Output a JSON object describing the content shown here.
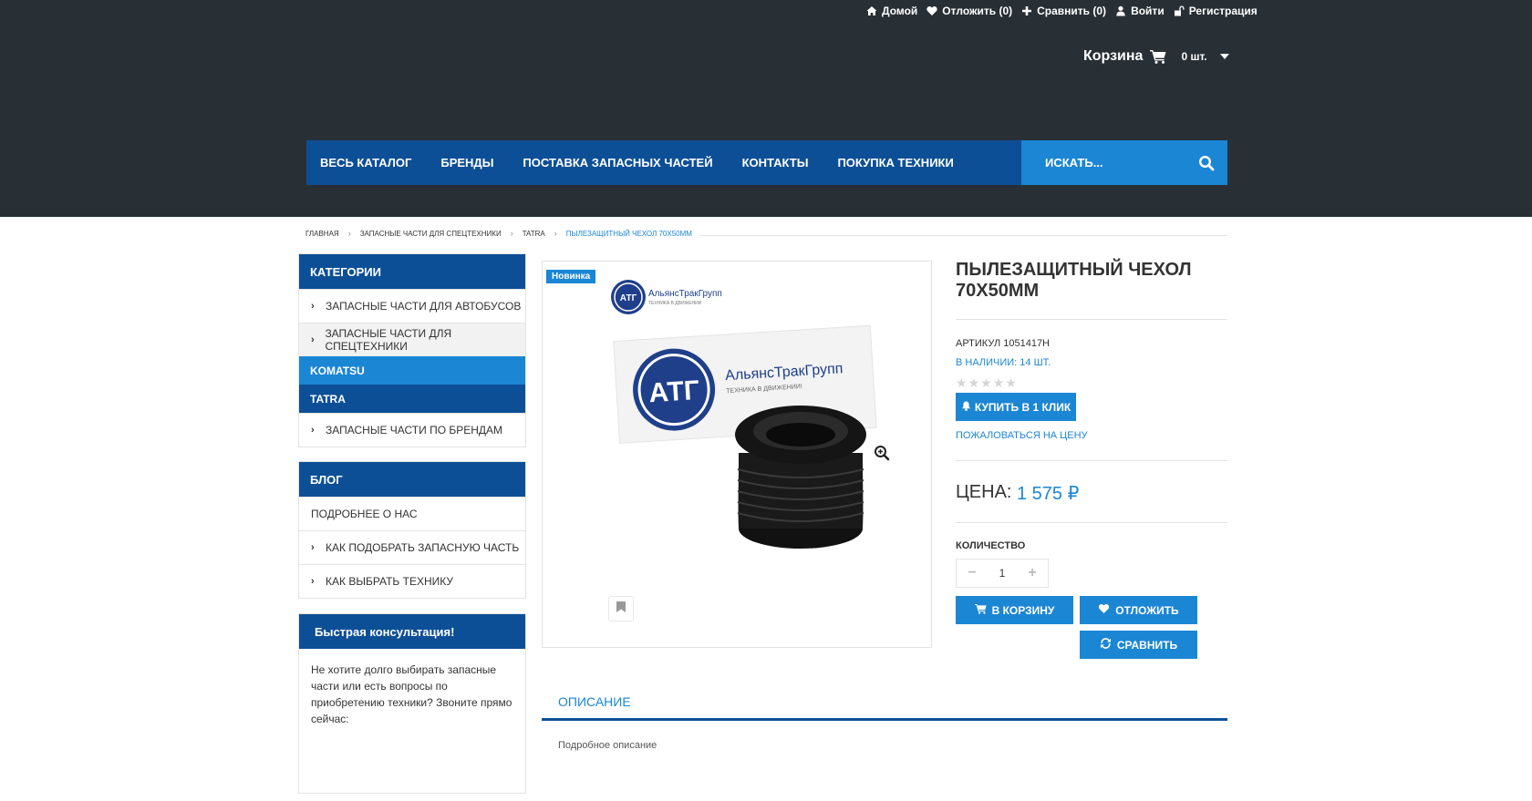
{
  "header": {
    "top_links": [
      {
        "label": "Домой",
        "icon": "home-icon"
      },
      {
        "label": "Отложить (0)",
        "icon": "heart-icon"
      },
      {
        "label": "Сравнить (0)",
        "icon": "plus-icon"
      },
      {
        "label": "Войти",
        "icon": "user-icon"
      },
      {
        "label": "Регистрация",
        "icon": "unlock-icon"
      }
    ],
    "cart": {
      "label": "Корзина",
      "count": "0 шт.",
      "icon": "cart-icon"
    },
    "nav": [
      "ВЕСЬ КАТАЛОГ",
      "БРЕНДЫ",
      "ПОСТАВКА ЗАПАСНЫХ ЧАСТЕЙ",
      "КОНТАКТЫ",
      "ПОКУПКА ТЕХНИКИ"
    ],
    "search": {
      "placeholder": "ИСКАТЬ...",
      "icon": "search-icon"
    }
  },
  "breadcrumb": [
    "ГЛАВНАЯ",
    "ЗАПАСНЫЕ ЧАСТИ ДЛЯ СПЕЦТЕХНИКИ",
    "TATRA",
    "ПЫЛЕЗАЩИТНЫЙ ЧЕХОЛ 70X50MM"
  ],
  "sidebar": {
    "categories": {
      "title": "КАТЕГОРИИ",
      "items": [
        "ЗАПАСНЫЕ ЧАСТИ ДЛЯ АВТОБУСОВ",
        "ЗАПАСНЫЕ ЧАСТИ ДЛЯ СПЕЦТЕХНИКИ",
        "KOMATSU",
        "TATRA",
        "ЗАПАСНЫЕ ЧАСТИ ПО БРЕНДАМ"
      ]
    },
    "blog": {
      "title": "БЛОГ",
      "items": [
        "ПОДРОБНЕЕ О НАС",
        "КАК ПОДОБРАТЬ ЗАПАСНУЮ ЧАСТЬ",
        "КАК ВЫБРАТЬ ТЕХНИКУ"
      ]
    },
    "consult": {
      "title": "Быстрая консультация!",
      "text": "Не хотите долго выбирать запасные части или есть вопросы по приобретению техники? Звоните прямо сейчас:"
    }
  },
  "product": {
    "badge": "Новинка",
    "logo_small_name": "АльянсТракГрупп",
    "logo_small_tagline": "ТЕХНИКА В ДВИЖЕНИИ",
    "logo_big_name": "АльянсТракГрупп",
    "logo_big_tagline": "ТЕХНИКА В ДВИЖЕНИИ!",
    "logo_mark": "АТГ",
    "title": "ПЫЛЕЗАЩИТНЫЙ ЧЕХОЛ 70X50MM",
    "sku": "АРТИКУЛ 1051417H",
    "stock": "В НАЛИЧИИ: 14 ШТ.",
    "rating": 0,
    "rating_max": 5,
    "buy_one_click": "КУПИТЬ В 1 КЛИК",
    "complain": "ПОЖАЛОВАТЬСЯ НА ЦЕНУ",
    "price_label": "ЦЕНА:",
    "price": "1 575 ₽",
    "qty_label": "КОЛИЧЕСТВО",
    "qty_value": "1",
    "qty_minus": "−",
    "qty_plus": "+",
    "add_to_cart": "В КОРЗИНУ",
    "wishlist": "ОТЛОЖИТЬ",
    "compare": "СРАВНИТЬ"
  },
  "tabs": {
    "description_label": "ОПИСАНИЕ",
    "description_text": "Подробное описание"
  },
  "colors": {
    "header_bg": "#283036",
    "nav_bg": "#0d4f96",
    "accent": "#1b86d4"
  }
}
